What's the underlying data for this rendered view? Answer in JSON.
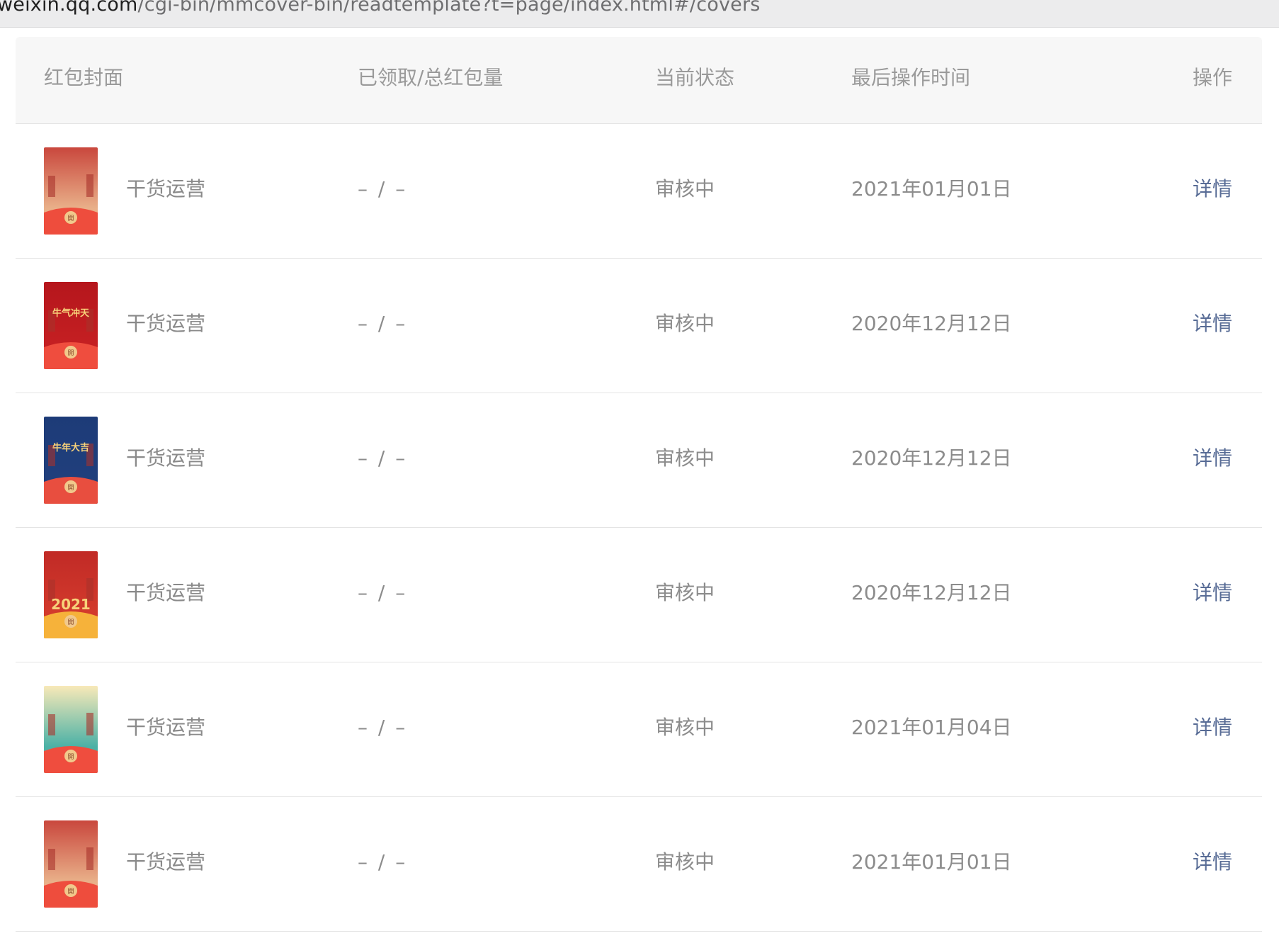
{
  "browser": {
    "url_host": "weixin.qq.com",
    "url_path": "/cgi-bin/mmcover-bin/readtemplate?t=page/index.html#/covers"
  },
  "table": {
    "headers": {
      "cover": "红包封面",
      "claimed_total": "已领取/总红包量",
      "status": "当前状态",
      "last_op_time": "最后操作时间",
      "action": "操作"
    },
    "rows": [
      {
        "name": "干货运营",
        "quantity": "– / –",
        "status": "审核中",
        "time": "2021年01月01日",
        "action": "详情"
      },
      {
        "name": "干货运营",
        "quantity": "– / –",
        "status": "审核中",
        "time": "2020年12月12日",
        "action": "详情"
      },
      {
        "name": "干货运营",
        "quantity": "– / –",
        "status": "审核中",
        "time": "2020年12月12日",
        "action": "详情"
      },
      {
        "name": "干货运营",
        "quantity": "– / –",
        "status": "审核中",
        "time": "2020年12月12日",
        "action": "详情"
      },
      {
        "name": "干货运营",
        "quantity": "– / –",
        "status": "审核中",
        "time": "2021年01月04日",
        "action": "详情"
      },
      {
        "name": "干货运营",
        "quantity": "– / –",
        "status": "审核中",
        "time": "2021年01月01日",
        "action": "详情"
      }
    ]
  },
  "covers": [
    {
      "icon": "festival-street-cover-thumbnail",
      "top": "#c9473d",
      "mid": "#e9b089",
      "bottom": "#ee4d3d",
      "text": ""
    },
    {
      "icon": "ox-year-red-cover-thumbnail",
      "top": "#b5161c",
      "mid": "#c41f22",
      "bottom": "#ef4d3e",
      "text": "牛气冲天"
    },
    {
      "icon": "blue-night-cover-thumbnail",
      "top": "#1d3b78",
      "mid": "#203f7c",
      "bottom": "#e84e3f",
      "text": "牛年大吉"
    },
    {
      "icon": "2021-red-cover-thumbnail",
      "top": "#c12a26",
      "mid": "#d23a2c",
      "bottom": "#f6b23a",
      "text": "2021"
    },
    {
      "icon": "cartoon-girl-cover-thumbnail",
      "top": "#f8e9b8",
      "mid": "#4bb1a6",
      "bottom": "#ef4d3e",
      "text": ""
    },
    {
      "icon": "festival-street-cover-thumbnail",
      "top": "#c9473d",
      "mid": "#e9b089",
      "bottom": "#ee4d3d",
      "text": ""
    }
  ],
  "cover_badge_text": "開"
}
